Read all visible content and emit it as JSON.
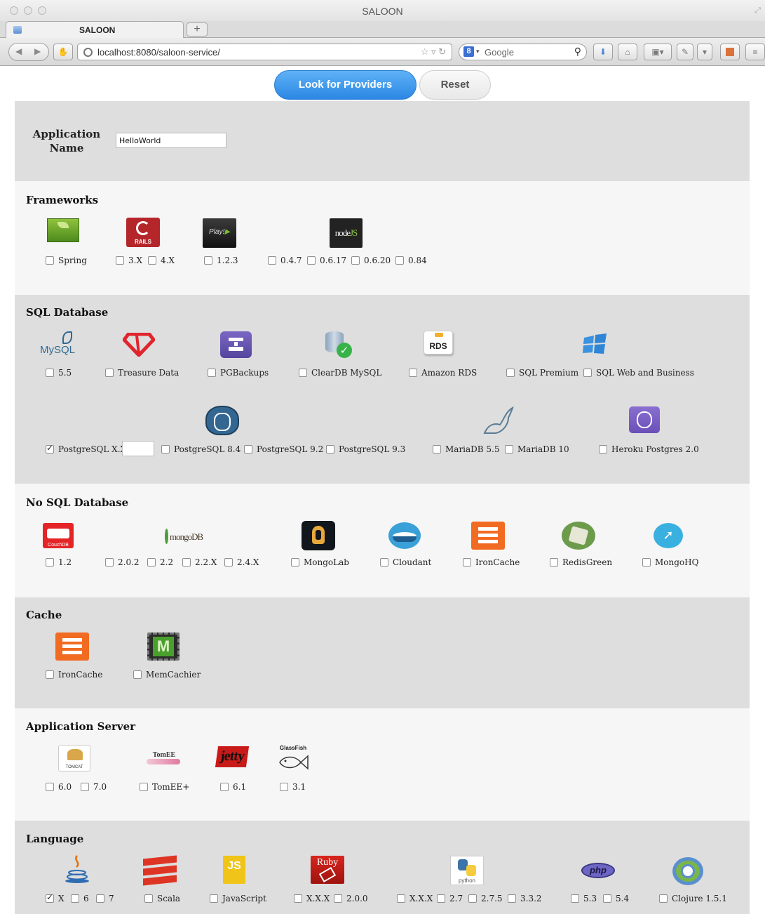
{
  "window": {
    "title": "SALOON"
  },
  "tab": {
    "label": "SALOON",
    "new_tab": "+"
  },
  "nav": {
    "url": "localhost:8080/saloon-service/",
    "search_placeholder": "Google",
    "search_engine": "8"
  },
  "actions": {
    "look": "Look for Providers",
    "reset": "Reset"
  },
  "app": {
    "label_line1": "Application",
    "label_line2": "Name",
    "value": "HelloWorld"
  },
  "frameworks": {
    "title": "Frameworks",
    "logo_rails": "RAILS",
    "logo_play": "Play!",
    "logo_node": "node",
    "logo_node_js": "JS",
    "options": {
      "spring": "Spring",
      "rails3": "3.X",
      "rails4": "4.X",
      "play": "1.2.3",
      "node047": "0.4.7",
      "node0617": "0.6.17",
      "node0620": "0.6.20",
      "node084": "0.84"
    }
  },
  "sql": {
    "title": "SQL Database",
    "logo_mysql": "MySQL",
    "logo_rds": "RDS",
    "options": {
      "mysql": "5.5",
      "treasure": "Treasure Data",
      "pgbackups": "PGBackups",
      "cleardb": "ClearDB MySQL",
      "rds": "Amazon RDS",
      "sqlpremium": "SQL Premium",
      "sqlweb": "SQL Web and Business",
      "pgxx": "PostgreSQL X.X",
      "pg84": "PostgreSQL 8.4",
      "pg92": "PostgreSQL 9.2",
      "pg93": "PostgreSQL 9.3",
      "maria55": "MariaDB 5.5",
      "maria10": "MariaDB 10",
      "heroku": "Heroku Postgres 2.0"
    }
  },
  "nosql": {
    "title": "No SQL Database",
    "logo_couch": "CouchDB",
    "logo_mongo": "mongoDB",
    "options": {
      "couch": "1.2",
      "m202": "2.0.2",
      "m22": "2.2",
      "m22x": "2.2.X",
      "m24x": "2.4.X",
      "mongolab": "MongoLab",
      "cloudant": "Cloudant",
      "ironcache": "IronCache",
      "redisgreen": "RedisGreen",
      "mongohq": "MongoHQ"
    }
  },
  "cache": {
    "title": "Cache",
    "logo_mem": "M",
    "options": {
      "ironcache": "IronCache",
      "memcachier": "MemCachier"
    }
  },
  "appserver": {
    "title": "Application Server",
    "logo_tomcat": "TOMCAT",
    "logo_tomee": "TomEE",
    "logo_jetty": "jetty",
    "logo_glassfish": "GlassFish",
    "options": {
      "t60": "6.0",
      "t70": "7.0",
      "tomee": "TomEE+",
      "jetty": "6.1",
      "glassfish": "3.1"
    }
  },
  "language": {
    "title": "Language",
    "logo_js": "JS",
    "logo_ruby": "Ruby",
    "logo_python": "python",
    "logo_php": "php",
    "options": {
      "javax": "X",
      "java6": "6",
      "java7": "7",
      "scala": "Scala",
      "javascript": "JavaScript",
      "rubyxxx": "X.X.X",
      "ruby200": "2.0.0",
      "pyxxx": "X.X.X",
      "py27": "2.7",
      "py275": "2.7.5",
      "py332": "3.3.2",
      "php53": "5.3",
      "php54": "5.4",
      "clojure": "Clojure 1.5.1"
    }
  },
  "colors": {
    "accent": "#2b87e3",
    "band_dark": "#dedede",
    "band_light": "#f6f6f6"
  }
}
